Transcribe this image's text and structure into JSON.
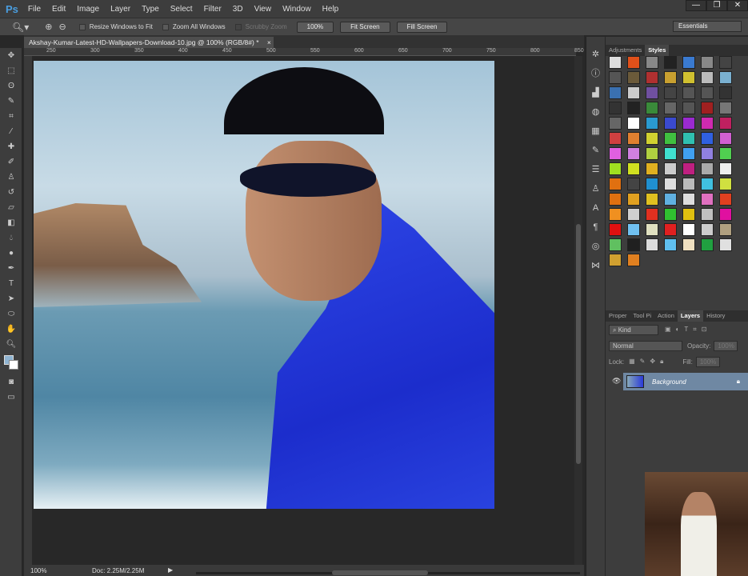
{
  "app": {
    "logo": "Ps",
    "menu": [
      "File",
      "Edit",
      "Image",
      "Layer",
      "Type",
      "Select",
      "Filter",
      "3D",
      "View",
      "Window",
      "Help"
    ],
    "window_buttons": [
      "—",
      "❐",
      "✕"
    ]
  },
  "options": {
    "resize_windows": "Resize Windows to Fit",
    "zoom_all": "Zoom All Windows",
    "scrubby": "Scrubby Zoom",
    "btn_100": "100%",
    "fit_screen": "Fit Screen",
    "fill_screen": "Fill Screen",
    "workspace": "Essentials"
  },
  "document": {
    "tab_title": "Akshay-Kumar-Latest-HD-Wallpapers-Download-10.jpg @ 100% (RGB/8#) *",
    "close": "×",
    "ruler": [
      "250",
      "300",
      "350",
      "400",
      "450",
      "500",
      "550",
      "600",
      "650",
      "700",
      "750",
      "800",
      "850"
    ]
  },
  "status": {
    "zoom": "100%",
    "doc": "Doc: 2.25M/2.25M"
  },
  "panels": {
    "top_tabs": [
      "Adjustments",
      "Styles"
    ],
    "layer_tabs": [
      "Proper",
      "Tool Pi",
      "Action",
      "Layers",
      "History"
    ],
    "kind": "Kind",
    "blend": "Normal",
    "opacity_label": "Opacity:",
    "opacity": "100%",
    "lock_label": "Lock:",
    "fill_label": "Fill:",
    "fill": "100%",
    "layer_name": "Background"
  },
  "style_colors": [
    "#ddd",
    "#e0501a",
    "#888",
    "#222",
    "#3a7ad0",
    "#888",
    "#444",
    "#555",
    "#6b5a3a",
    "#b03030",
    "#c8a030",
    "#d0c030",
    "#bbb",
    "#7ab0d0",
    "#3a70b0",
    "#ccc",
    "#7050a0",
    "#444",
    "#555",
    "#555",
    "#333",
    "#333",
    "#222",
    "#3a8a3a",
    "#666",
    "#555",
    "#a02020",
    "#777",
    "#666",
    "#fff",
    "#2a9ad0",
    "#3a4ad0",
    "#9a2ad0",
    "#d02ab0",
    "#c02060",
    "#d04040",
    "#e08030",
    "#d0d030",
    "#40c040",
    "#30c0b0",
    "#3060e0",
    "#d060d0",
    "#e060e0",
    "#d080e0",
    "#b0d040",
    "#40e0d0",
    "#40a0f0",
    "#9080e0",
    "#50d050",
    "#a0e020",
    "#d0e020",
    "#e0b020",
    "#ccc",
    "#c02080",
    "#aaa",
    "#eee",
    "#e07010",
    "#444",
    "#2090d0",
    "#ddd",
    "#bbb",
    "#40c0e0",
    "#d0e040",
    "#e07010",
    "#e0a020",
    "#e0c020",
    "#60b0e0",
    "#ddd",
    "#e070c0",
    "#e04020",
    "#f09020",
    "#d0d0d0",
    "#e03020",
    "#30c030",
    "#e0c010",
    "#c0c0c0",
    "#e010a0",
    "#e01010",
    "#70c0f0",
    "#e0e0c0",
    "#e02020",
    "#fff",
    "#ccc",
    "#b0a080",
    "#60c060",
    "#202020",
    "#ddd",
    "#60c0f0",
    "#f0e0c0",
    "#20a040",
    "#e0e0e0",
    "#d0a030",
    "#e08020"
  ]
}
